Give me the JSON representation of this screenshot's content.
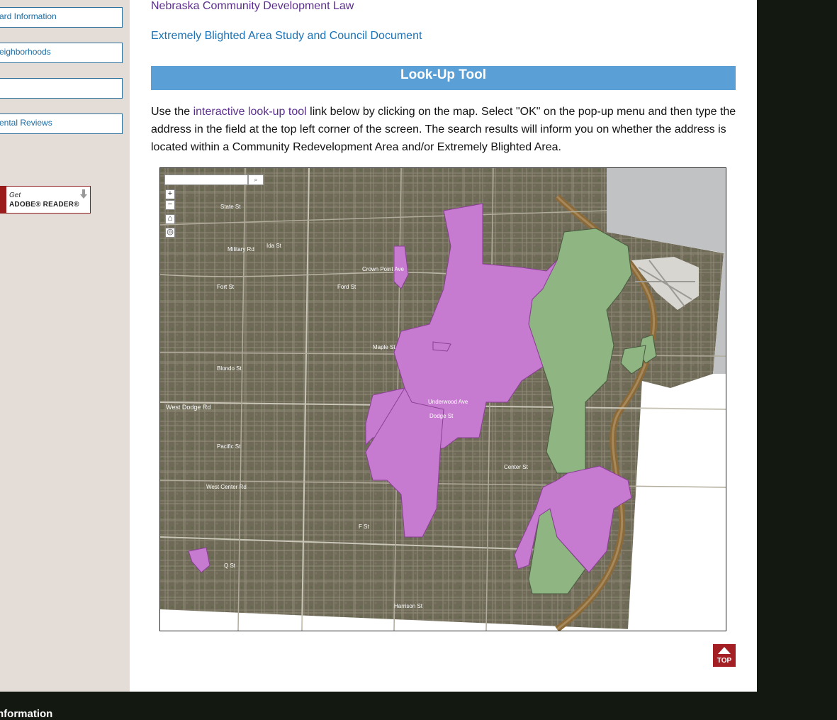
{
  "sidebar": {
    "links": [
      {
        "label": "ard Information"
      },
      {
        "label": "eighborhoods"
      },
      {
        "label": ""
      },
      {
        "label": "ental Reviews"
      }
    ],
    "adobe": {
      "get": "Get",
      "name": "ADOBE® READER®"
    }
  },
  "content": {
    "law_link": "Nebraska Community Development Law",
    "blight_link": "Extremely Blighted Area Study and Council Document",
    "lookup_title": "Look-Up Tool",
    "instructions": {
      "before": "Use the ",
      "link": "interactive look-up tool",
      "after": " link below by clicking on the map.  Select \"OK\" on the pop-up menu and then type the address in the field at the top left corner of the screen. The search results will inform you on whether the address is located within a Community Redevelopment Area and/or Extremely Blighted Area."
    },
    "top_label": "TOP"
  },
  "map": {
    "labels": [
      {
        "text": "State St"
      },
      {
        "text": "Military Rd"
      },
      {
        "text": "Ida St"
      },
      {
        "text": "Fort St"
      },
      {
        "text": "Ford St"
      },
      {
        "text": "Crown Point Ave"
      },
      {
        "text": "Maple St"
      },
      {
        "text": "Blondo St"
      },
      {
        "text": "West Dodge Rd"
      },
      {
        "text": "Dodge St"
      },
      {
        "text": "Underwood Ave"
      },
      {
        "text": "Pacific St"
      },
      {
        "text": "Center St"
      },
      {
        "text": "West Center Rd"
      },
      {
        "text": "Q St"
      },
      {
        "text": "F St"
      },
      {
        "text": "Harrison St"
      }
    ]
  },
  "footer": {
    "heading": "nformation"
  }
}
